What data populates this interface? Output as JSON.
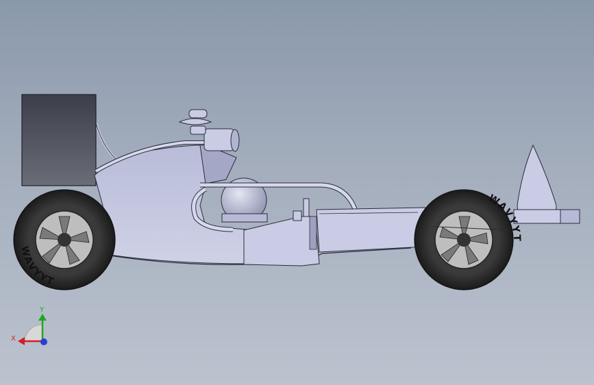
{
  "tyre_brand": "WAVYYT",
  "triad": {
    "x_label": "X",
    "y_label": "Y",
    "x_color": "#d42020",
    "y_color": "#1fa81f",
    "z_color": "#2a3fd6"
  },
  "colors": {
    "background_top": "#8a98ab",
    "background_bottom": "#bcc3cf",
    "body": "#c3c6e0",
    "body_edge": "#2a2c3a",
    "tyre": "#2d2d2d",
    "rim": "#bebebe",
    "wing": "#454854"
  }
}
